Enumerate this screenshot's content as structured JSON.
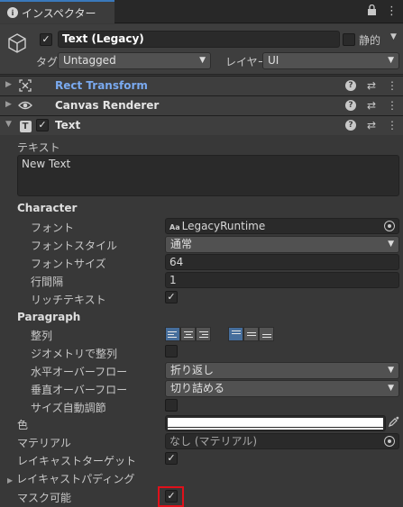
{
  "tab": {
    "title": "インスペクター",
    "lock_icon": "lock-icon",
    "menu_icon": "kebab-menu-icon"
  },
  "header": {
    "object_name": "Text (Legacy)",
    "static_label": "静的",
    "tag_label": "タグ",
    "tag_value": "Untagged",
    "layer_label": "レイヤー",
    "layer_value": "UI"
  },
  "components": {
    "rect_transform": "Rect Transform",
    "canvas_renderer": "Canvas Renderer",
    "text": "Text"
  },
  "text_component": {
    "text_label": "テキスト",
    "text_value": "New Text",
    "character_header": "Character",
    "font_label": "フォント",
    "font_value": "LegacyRuntime",
    "font_icon_text": "Aa",
    "font_style_label": "フォントスタイル",
    "font_style_value": "通常",
    "font_size_label": "フォントサイズ",
    "font_size_value": "64",
    "line_spacing_label": "行間隔",
    "line_spacing_value": "1",
    "rich_text_label": "リッチテキスト",
    "paragraph_header": "Paragraph",
    "alignment_label": "整列",
    "align_by_geometry_label": "ジオメトリで整列",
    "horizontal_overflow_label": "水平オーバーフロー",
    "horizontal_overflow_value": "折り返し",
    "vertical_overflow_label": "垂直オーバーフロー",
    "vertical_overflow_value": "切り詰める",
    "best_fit_label": "サイズ自動調節",
    "color_label": "色",
    "color_value": "#ffffff",
    "material_label": "マテリアル",
    "material_value": "なし (マテリアル)",
    "raycast_target_label": "レイキャストターゲット",
    "raycast_padding_label": "レイキャストパディング",
    "maskable_label": "マスク可能"
  },
  "checks": {
    "active": true,
    "static": false,
    "text_enabled": true,
    "rich_text": true,
    "align_by_geometry": false,
    "best_fit": false,
    "raycast_target": true,
    "maskable": true
  },
  "colors": {
    "accent_link": "#7aaaf0",
    "highlight_box": "#e0101a",
    "selected_align": "#466e9c"
  },
  "checkmark_glyph": "✓"
}
